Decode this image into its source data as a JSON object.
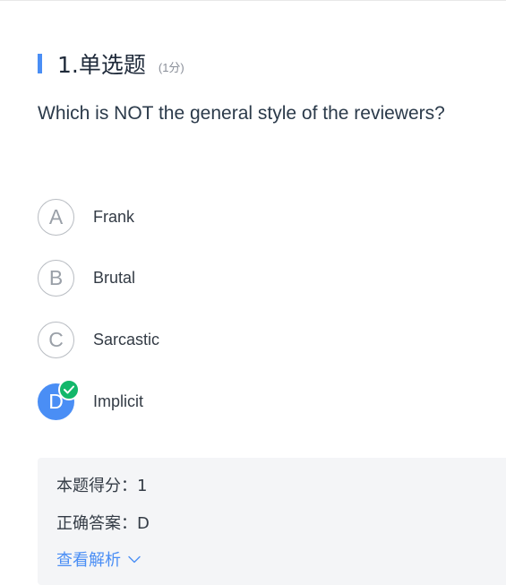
{
  "question": {
    "title": "1.单选题",
    "score": "(1分)",
    "text": "Which is NOT the general style of the reviewers?"
  },
  "options": [
    {
      "letter": "A",
      "label": "Frank",
      "selected": false
    },
    {
      "letter": "B",
      "label": "Brutal",
      "selected": false
    },
    {
      "letter": "C",
      "label": "Sarcastic",
      "selected": false
    },
    {
      "letter": "D",
      "label": "Implicit",
      "selected": true
    }
  ],
  "result": {
    "score_text": "本题得分：1",
    "answer_text": "正确答案：D",
    "analysis_link": "查看解析"
  },
  "colors": {
    "accent": "#4a8ef5",
    "correct": "#12b76a"
  },
  "icons": {
    "check": "check-badge-icon",
    "chevron": "chevron-down-icon"
  }
}
